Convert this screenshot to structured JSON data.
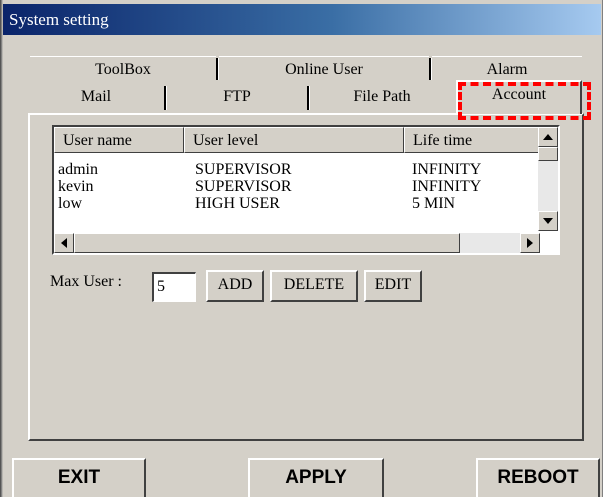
{
  "window": {
    "title": "System setting"
  },
  "tabs": {
    "row1": [
      {
        "label": "ToolBox"
      },
      {
        "label": "Online User"
      },
      {
        "label": "Alarm"
      }
    ],
    "row2": [
      {
        "label": "Mail"
      },
      {
        "label": "FTP"
      },
      {
        "label": "File Path"
      },
      {
        "label": "Account"
      }
    ],
    "active": "Account"
  },
  "user_table": {
    "columns": [
      "User name",
      "User level",
      "Life time"
    ],
    "rows": [
      [
        "admin",
        "SUPERVISOR",
        "INFINITY"
      ],
      [
        "kevin",
        "SUPERVISOR",
        "INFINITY"
      ],
      [
        "low",
        "HIGH USER",
        "5 MIN"
      ]
    ]
  },
  "max_user": {
    "label": "Max User :",
    "value": "5"
  },
  "actions": {
    "add": "ADD",
    "delete": "DELETE",
    "edit": "EDIT"
  },
  "footer": {
    "exit": "EXIT",
    "apply": "APPLY",
    "reboot": "REBOOT"
  },
  "colors": {
    "highlight": "#ff0000",
    "face": "#d4d0c8",
    "titlebar": "#0a246a"
  }
}
